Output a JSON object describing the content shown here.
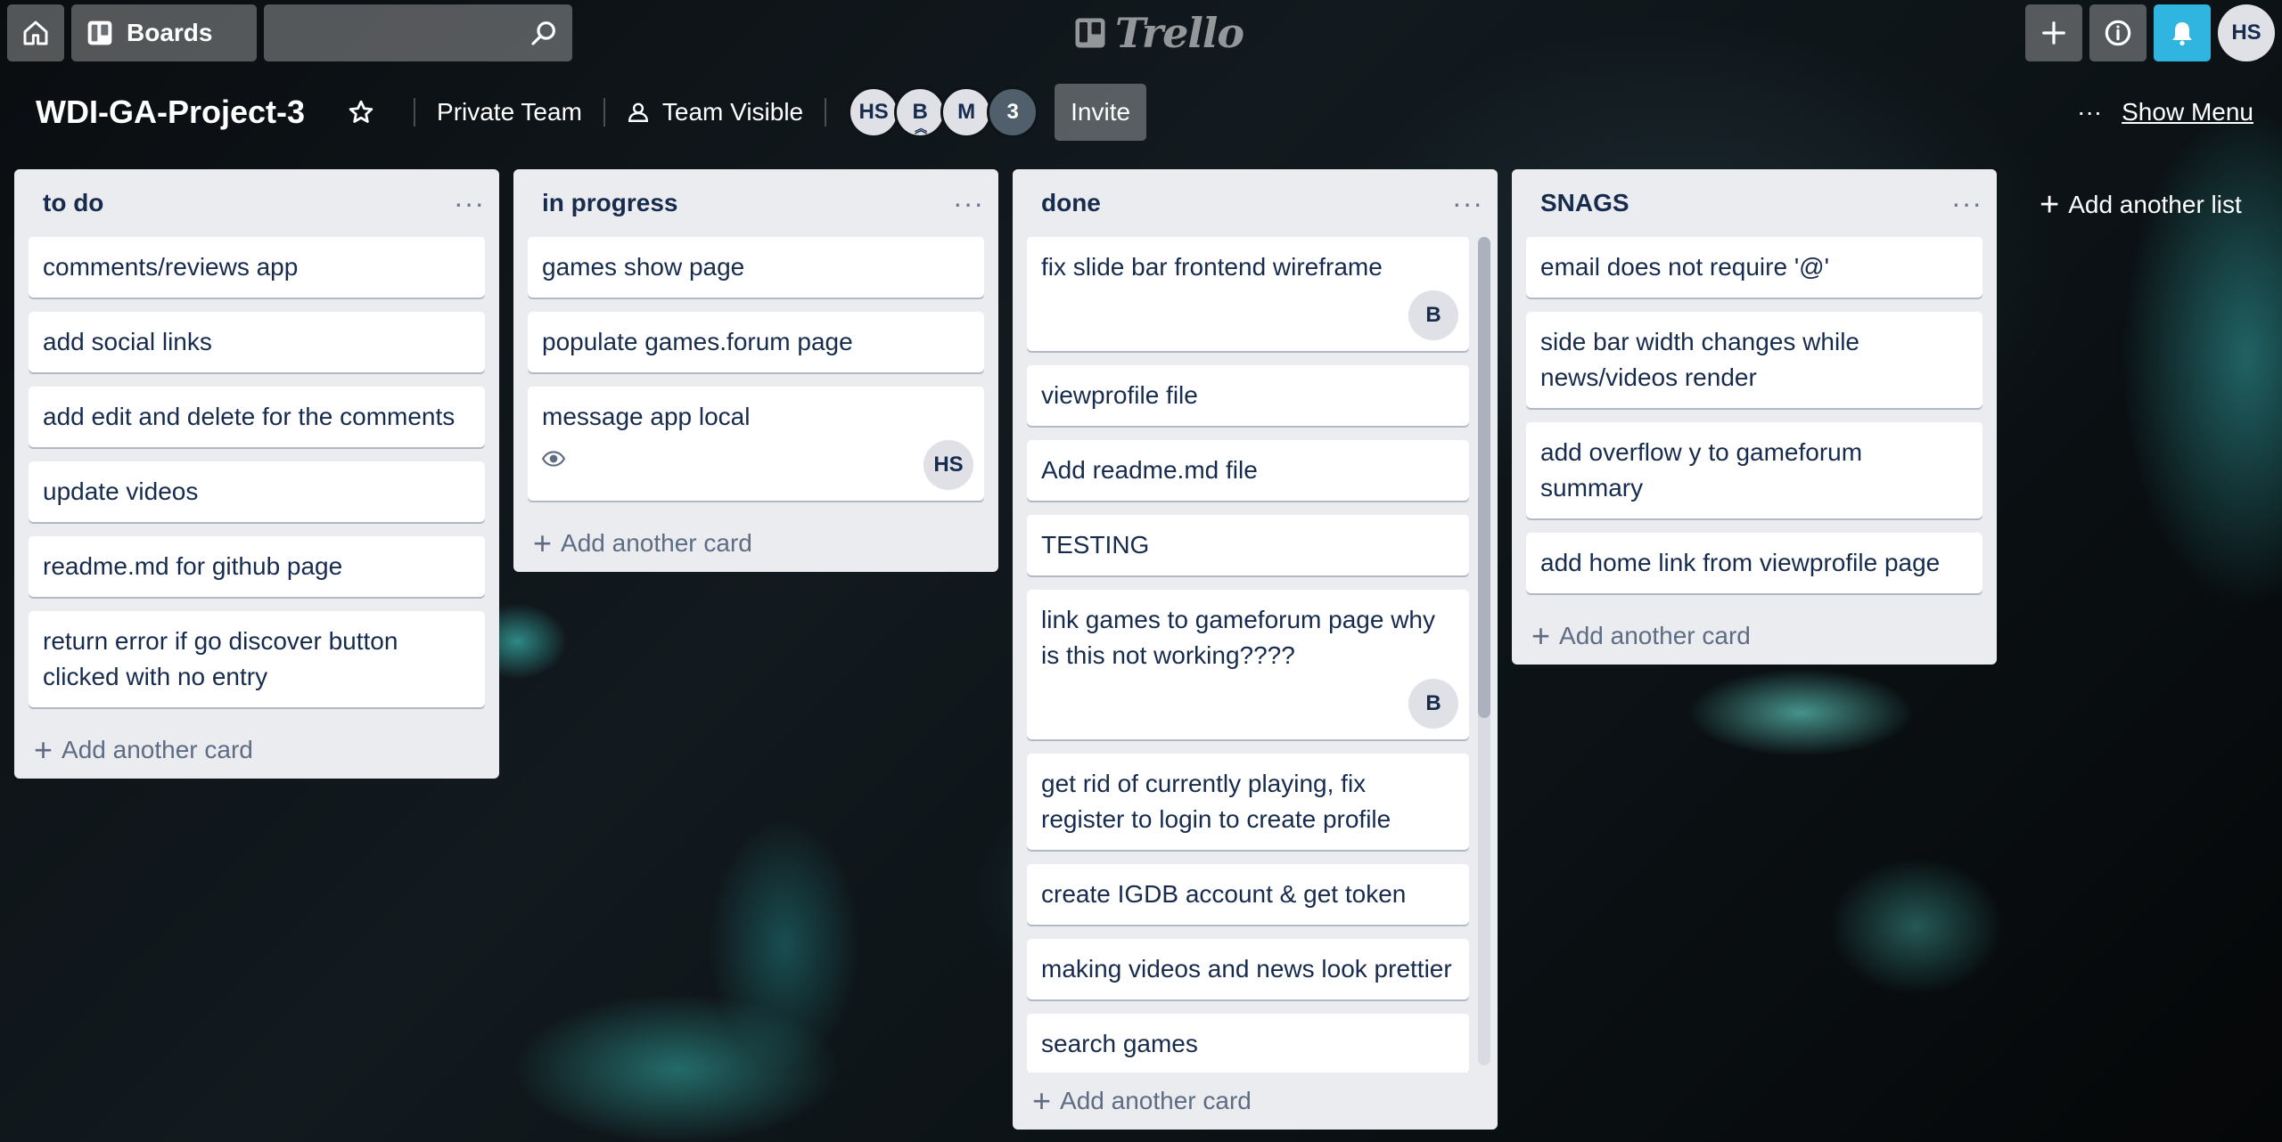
{
  "header": {
    "boards_label": "Boards",
    "search_placeholder": "",
    "logo_text": "Trello",
    "user_initials": "HS",
    "colors": {
      "bell": "#2fb5e0"
    }
  },
  "board": {
    "title": "WDI-GA-Project-3",
    "team": "Private Team",
    "visibility": "Team Visible",
    "members": [
      "HS",
      "B",
      "M"
    ],
    "member_extra_count": "3",
    "invite_label": "Invite",
    "menu_dots": "···",
    "show_menu_label": "Show Menu",
    "add_list_label": "Add another list"
  },
  "lists": [
    {
      "title": "to do",
      "cards": [
        {
          "text": "comments/reviews app"
        },
        {
          "text": "add social links"
        },
        {
          "text": "add edit and delete for the comments"
        },
        {
          "text": "update videos"
        },
        {
          "text": "readme.md for github page"
        },
        {
          "text": "return error if go discover button clicked with no entry"
        }
      ],
      "add_label": "Add another card"
    },
    {
      "title": "in progress",
      "cards": [
        {
          "text": "games show page"
        },
        {
          "text": "populate games.forum page"
        },
        {
          "text": "message app local",
          "member": "HS",
          "watching": true
        }
      ],
      "add_label": "Add another card"
    },
    {
      "title": "done",
      "cards": [
        {
          "text": "fix slide bar frontend wireframe",
          "member": "B"
        },
        {
          "text": "viewprofile file"
        },
        {
          "text": "Add readme.md file"
        },
        {
          "text": "TESTING"
        },
        {
          "text": "link games to gameforum page why is this not working????",
          "member": "B"
        },
        {
          "text": "get rid of currently playing, fix register to login to create profile"
        },
        {
          "text": "create IGDB account & get token"
        },
        {
          "text": "making videos and news look prettier"
        },
        {
          "text": "search games"
        }
      ],
      "add_label": "Add another card"
    },
    {
      "title": "SNAGS",
      "cards": [
        {
          "text": "email does not require '@'"
        },
        {
          "text": "side bar width changes while news/videos render"
        },
        {
          "text": "add overflow y to gameforum summary"
        },
        {
          "text": "add home link from viewprofile page"
        }
      ],
      "add_label": "Add another card"
    }
  ],
  "list_menu_dots": "···"
}
